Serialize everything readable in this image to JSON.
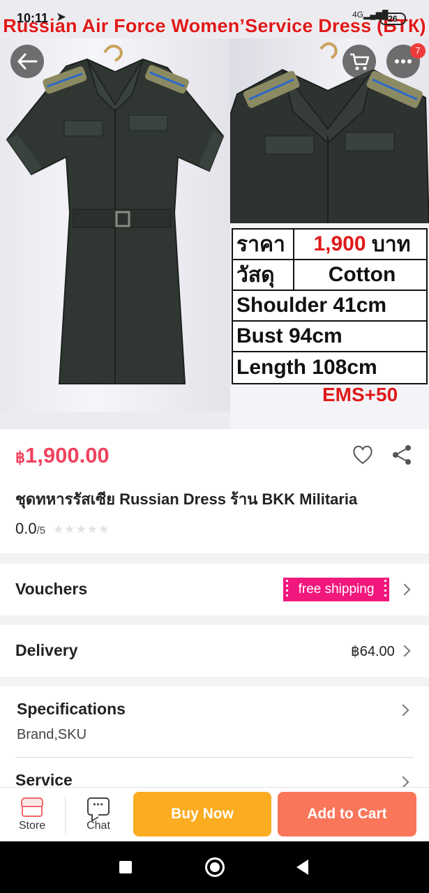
{
  "status_bar": {
    "time": "10:11",
    "network": "4G",
    "battery": "26"
  },
  "hero": {
    "banner_title": "Russian Air Force Women’Service Dress (БТК)",
    "cart_badge": "7",
    "info_table": [
      {
        "key": "ราคา",
        "value": "1,900",
        "suffix": "บาท"
      },
      {
        "key": "วัสดุ",
        "value": "Cotton"
      },
      {
        "full": "Shoulder 41cm"
      },
      {
        "full": "Bust 94cm"
      },
      {
        "full": "Length 108cm"
      }
    ],
    "shipping_note": "EMS+50"
  },
  "product": {
    "currency_symbol": "฿",
    "price": "1,900.00",
    "name": "ชุดทหารรัสเซีย Russian Dress ร้าน BKK Militaria",
    "rating_value": "0.0",
    "rating_max": "/5",
    "stars_filled": 0,
    "stars_total": 5
  },
  "vouchers": {
    "label": "Vouchers",
    "tag": "free shipping"
  },
  "delivery": {
    "label": "Delivery",
    "fee": "฿64.00"
  },
  "specifications": {
    "label": "Specifications",
    "sub": "Brand,SKU"
  },
  "service": {
    "label": "Service"
  },
  "action_bar": {
    "store_label": "Store",
    "chat_label": "Chat",
    "buy_now": "Buy Now",
    "add_to_cart": "Add to Cart"
  },
  "colors": {
    "price": "#f0435f",
    "buy_now": "#fcac20",
    "add_to_cart": "#f9765a",
    "voucher_tag": "#f2177c",
    "banner_text": "#e01919"
  },
  "icons": [
    "back-arrow-icon",
    "cart-icon",
    "more-icon",
    "heart-icon",
    "share-icon",
    "chevron-right-icon",
    "store-icon",
    "chat-icon"
  ]
}
